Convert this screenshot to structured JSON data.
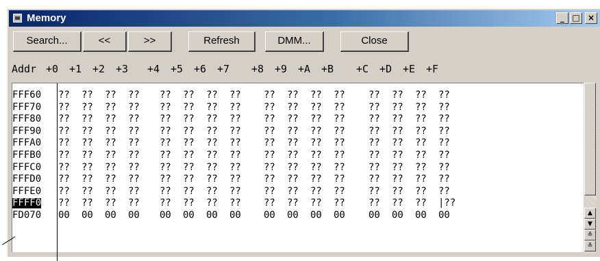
{
  "window": {
    "title": "Memory",
    "controls": [
      "_",
      "□",
      "×"
    ]
  },
  "toolbar": {
    "search": "Search...",
    "prev": "<<",
    "next": ">>",
    "refresh": "Refresh",
    "dmm": "DMM...",
    "close": "Close"
  },
  "header": {
    "addr": "Addr",
    "cols": [
      "+0",
      "+1",
      "+2",
      "+3",
      "+4",
      "+5",
      "+6",
      "+7",
      "+8",
      "+9",
      "+A",
      "+B",
      "+C",
      "+D",
      "+E",
      "+F"
    ]
  },
  "rows": [
    {
      "addr": "FFF60",
      "cells": [
        "??",
        "??",
        "??",
        "??",
        "??",
        "??",
        "??",
        "??",
        "??",
        "??",
        "??",
        "??",
        "??",
        "??",
        "??",
        "??"
      ]
    },
    {
      "addr": "FFF70",
      "cells": [
        "??",
        "??",
        "??",
        "??",
        "??",
        "??",
        "??",
        "??",
        "??",
        "??",
        "??",
        "??",
        "??",
        "??",
        "??",
        "??"
      ]
    },
    {
      "addr": "FFF80",
      "cells": [
        "??",
        "??",
        "??",
        "??",
        "??",
        "??",
        "??",
        "??",
        "??",
        "??",
        "??",
        "??",
        "??",
        "??",
        "??",
        "??"
      ]
    },
    {
      "addr": "FFF90",
      "cells": [
        "??",
        "??",
        "??",
        "??",
        "??",
        "??",
        "??",
        "??",
        "??",
        "??",
        "??",
        "??",
        "??",
        "??",
        "??",
        "??"
      ]
    },
    {
      "addr": "FFFA0",
      "cells": [
        "??",
        "??",
        "??",
        "??",
        "??",
        "??",
        "??",
        "??",
        "??",
        "??",
        "??",
        "??",
        "??",
        "??",
        "??",
        "??"
      ]
    },
    {
      "addr": "FFFB0",
      "cells": [
        "??",
        "??",
        "??",
        "??",
        "??",
        "??",
        "??",
        "??",
        "??",
        "??",
        "??",
        "??",
        "??",
        "??",
        "??",
        "??"
      ]
    },
    {
      "addr": "FFFC0",
      "cells": [
        "??",
        "??",
        "??",
        "??",
        "??",
        "??",
        "??",
        "??",
        "??",
        "??",
        "??",
        "??",
        "??",
        "??",
        "??",
        "??"
      ]
    },
    {
      "addr": "FFFD0",
      "cells": [
        "??",
        "??",
        "??",
        "??",
        "??",
        "??",
        "??",
        "??",
        "??",
        "??",
        "??",
        "??",
        "??",
        "??",
        "??",
        "??"
      ]
    },
    {
      "addr": "FFFE0",
      "cells": [
        "??",
        "??",
        "??",
        "??",
        "??",
        "??",
        "??",
        "??",
        "??",
        "??",
        "??",
        "??",
        "??",
        "??",
        "??",
        "??"
      ]
    },
    {
      "addr": "FFFF0",
      "selected": true,
      "cells": [
        "??",
        "??",
        "??",
        "??",
        "??",
        "??",
        "??",
        "??",
        "??",
        "??",
        "??",
        "??",
        "??",
        "??",
        "??",
        "|??"
      ]
    },
    {
      "addr": "FD070",
      "cells": [
        "00",
        "00",
        "00",
        "00",
        "00",
        "00",
        "00",
        "00",
        "00",
        "00",
        "00",
        "00",
        "00",
        "00",
        "00",
        "00"
      ]
    }
  ],
  "scrollbar": {
    "up": "▲",
    "down": "▼",
    "page_up": "≙",
    "page_down": "≚"
  }
}
